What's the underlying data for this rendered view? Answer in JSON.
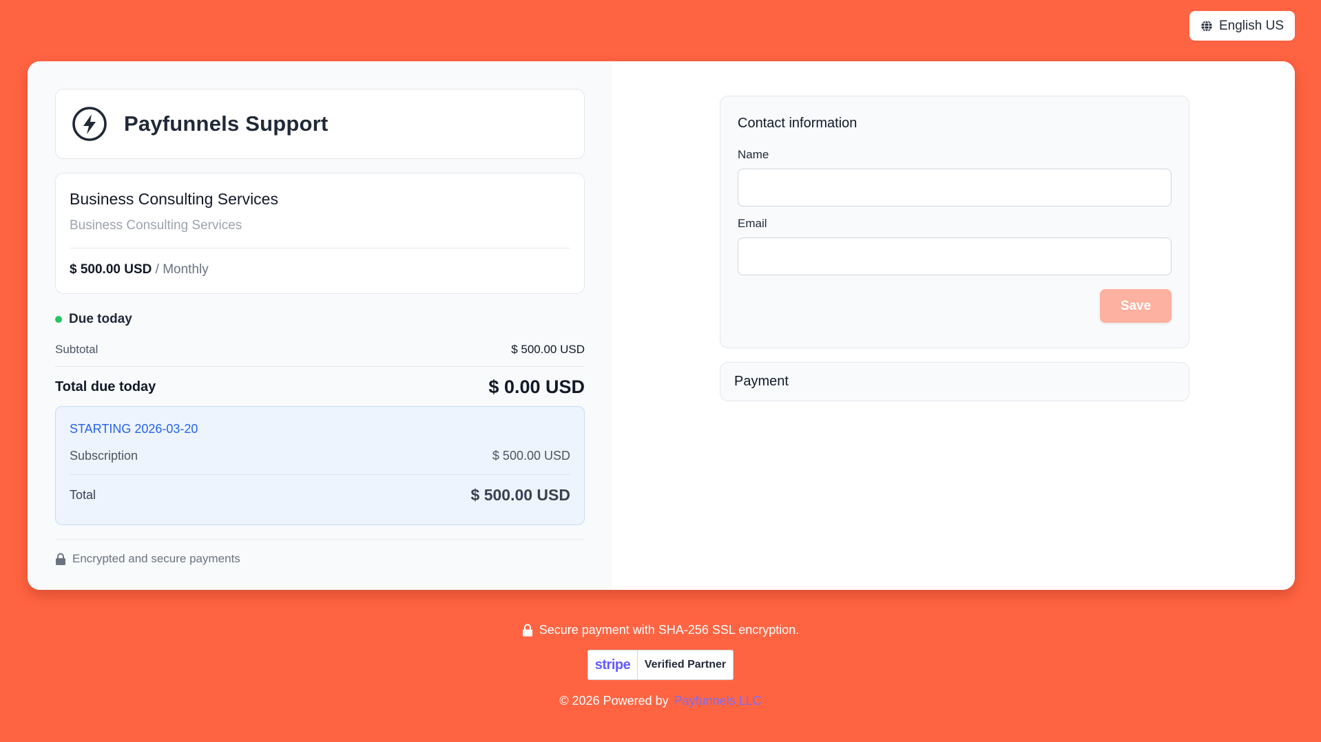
{
  "header": {
    "language_label": "English US",
    "language_icon": "globe-icon"
  },
  "brand": {
    "title": "Payfunnels Support",
    "icon": "lightning-bolt-icon"
  },
  "product": {
    "name": "Business Consulting Services",
    "description": "Business Consulting Services",
    "price": "$ 500.00 USD",
    "period": "/ Monthly"
  },
  "summary": {
    "due_label": "Due today",
    "subtotal_label": "Subtotal",
    "subtotal_value": "$ 500.00 USD",
    "total_due_label": "Total due today",
    "total_due_value": "$ 0.00 USD"
  },
  "schedule": {
    "starting_label": "STARTING 2026-03-20",
    "subscription_label": "Subscription",
    "subscription_value": "$ 500.00 USD",
    "total_label": "Total",
    "total_value": "$ 500.00 USD"
  },
  "security_note": "Encrypted and secure payments",
  "contact": {
    "title": "Contact information",
    "name_label": "Name",
    "name_value": "",
    "email_label": "Email",
    "email_value": "",
    "save_label": "Save"
  },
  "payment": {
    "title": "Payment"
  },
  "footer": {
    "ssl_text": "Secure payment with SHA-256 SSL encryption.",
    "stripe_logo": "stripe",
    "stripe_badge_text": "Verified Partner",
    "copyright_text": "© 2026 Powered by",
    "company_link": "Payfunnels LLC"
  },
  "colors": {
    "background": "#ff6442",
    "accent_blue": "#2563eb",
    "status_green": "#22c55e",
    "save_button": "#fdb1a0",
    "stripe_purple": "#635bff"
  }
}
